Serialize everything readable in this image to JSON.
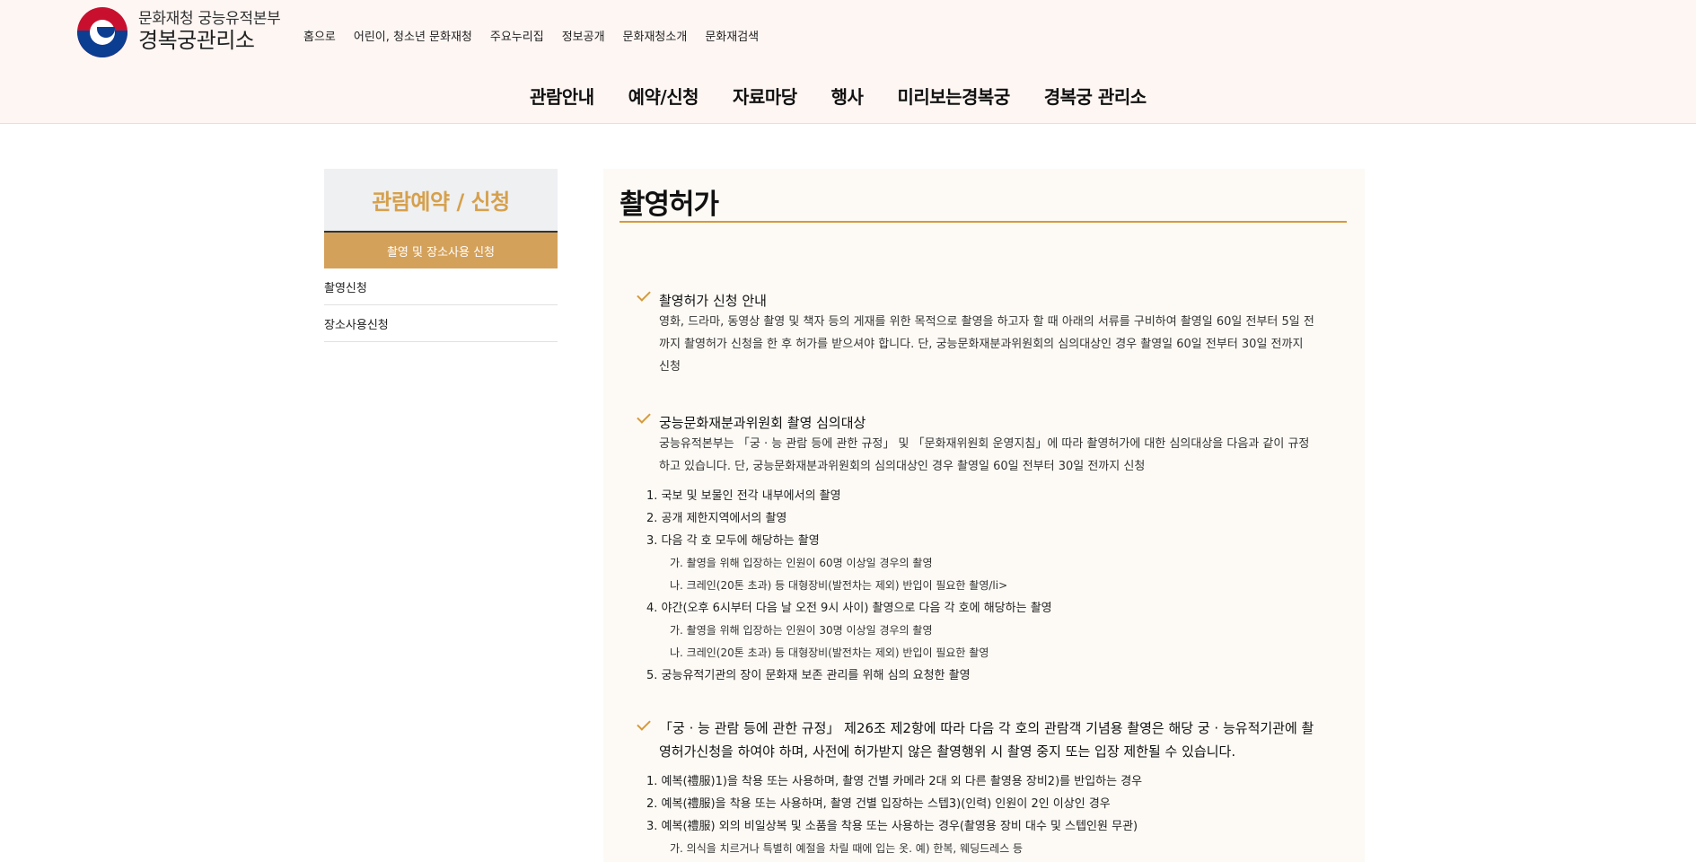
{
  "header": {
    "logo_line1": "문화재청 궁능유적본부",
    "logo_line2": "경복궁관리소",
    "util_nav": [
      "홈으로",
      "어린이, 청소년 문화재청",
      "주요누리집",
      "정보공개",
      "문화재청소개",
      "문화재검색"
    ],
    "gnb": [
      "관람안내",
      "예약/신청",
      "자료마당",
      "행사",
      "미리보는경복궁",
      "경복궁 관리소"
    ]
  },
  "sidebar": {
    "title": "관람예약 / 신청",
    "active": "촬영 및 장소사용 신청",
    "items": [
      "촬영신청",
      "장소사용신청"
    ]
  },
  "content": {
    "title": "촬영허가",
    "sec1": {
      "title": "촬영허가 신청 안내",
      "body": "영화, 드라마, 동영상 촬영 및 책자 등의 게재를 위한 목적으로 촬영을 하고자 할 때 아래의 서류를 구비하여 촬영일 60일 전부터 5일 전까지 촬영허가 신청을 한 후 허가를 받으셔야 합니다. 단, 궁능문화재분과위원회의 심의대상인 경우 촬영일 60일 전부터 30일 전까지 신청"
    },
    "sec2": {
      "title": "궁능문화재분과위원회 촬영 심의대상",
      "body": "궁능유적본부는 「궁 · 능 관람 등에 관한 규정」 및 「문화재위원회 운영지침」에 따라 촬영허가에 대한 심의대상을 다음과 같이 규정하고 있습니다. 단, 궁능문화재분과위원회의 심의대상인 경우 촬영일 60일 전부터 30일 전까지 신청",
      "list": [
        "1. 국보 및 보물인 전각 내부에서의 촬영",
        "2. 공개 제한지역에서의 촬영",
        "3. 다음 각 호 모두에 해당하는 촬영",
        "가. 촬영을 위해 입장하는 인원이 60명 이상일 경우의 촬영",
        "나. 크레인(20톤 초과) 등 대형장비(발전차는 제외) 반입이 필요한 촬영/li>",
        "4. 야간(오후 6시부터 다음 날 오전 9시 사이) 촬영으로 다음 각 호에 해당하는 촬영",
        "가. 촬영을 위해 입장하는 인원이 30명 이상일 경우의 촬영",
        "나. 크레인(20톤 초과) 등 대형장비(발전차는 제외) 반입이 필요한 촬영",
        "5. 궁능유적기관의 장이 문화재 보존 관리를 위해 심의 요청한 촬영"
      ]
    },
    "sec3": {
      "title": "「궁 · 능 관람 등에 관한 규정」 제26조 제2항에 따라 다음 각 호의 관람객 기념용 촬영은 해당 궁 · 능유적기관에 촬영허가신청을 하여야 하며, 사전에 허가받지 않은 촬영행위 시 촬영 중지 또는 입장 제한될 수 있습니다.",
      "list": [
        "1. 예복(禮服)1)을 착용 또는 사용하며, 촬영 건별 카메라 2대 외 다른 촬영용 장비2)를 반입하는 경우",
        "2. 예복(禮服)을 착용 또는 사용하며, 촬영 건별 입장하는 스텝3)(인력) 인원이 2인 이상인 경우",
        "3. 예복(禮服) 외의 비일상복 및 소품을 착용 또는 사용하는 경우(촬영용 장비 대수 및 스텝인원 무관)",
        "가. 의식을 치르거나 특별히 예절을 차릴 때에 입는 옷. 예) 한복, 웨딩드레스 등"
      ]
    }
  },
  "colors": {
    "accent": "#d69a3a",
    "sidebar_active": "#d4a15a",
    "header_bg": "#fdf6f3"
  }
}
